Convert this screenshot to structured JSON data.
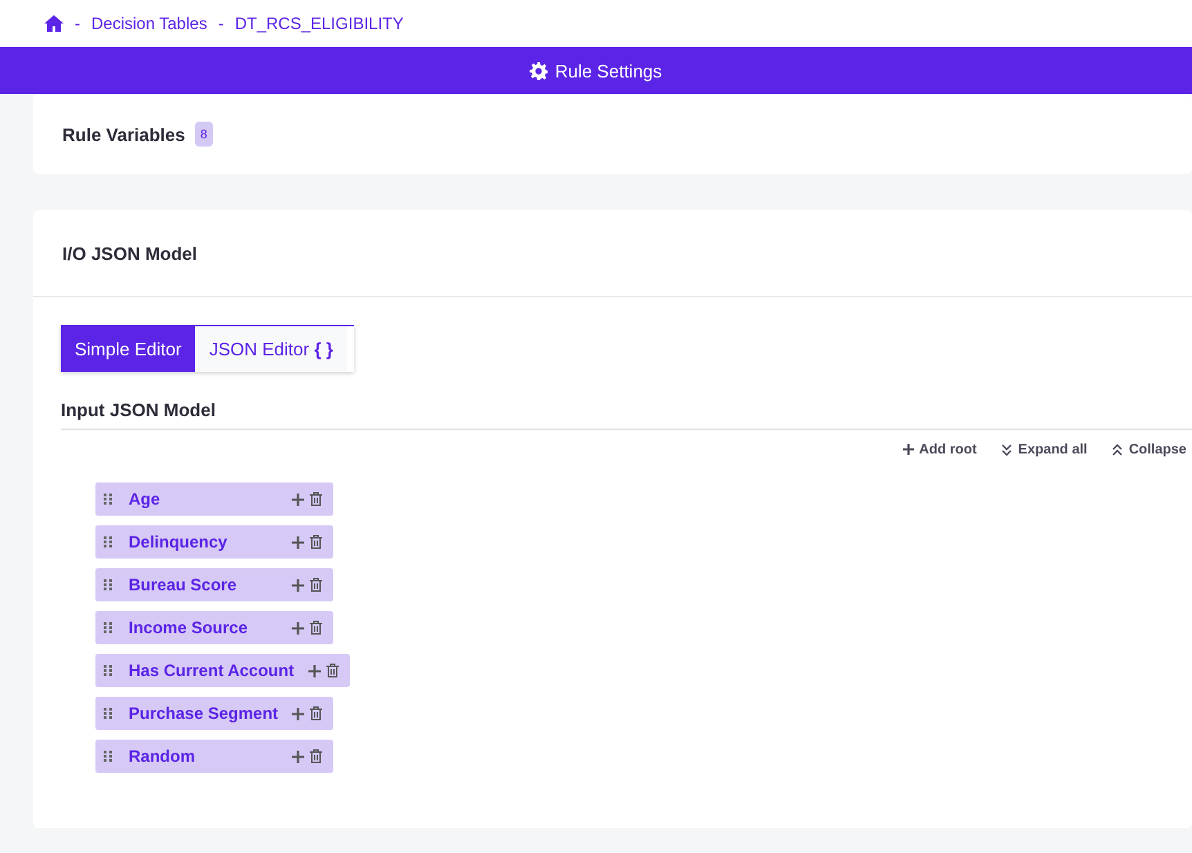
{
  "breadcrumb": [
    {
      "separator": "-",
      "label": "Decision Tables"
    },
    {
      "separator": "-",
      "label": "DT_RCS_ELIGIBILITY"
    }
  ],
  "header_bar": {
    "title": "Rule Settings"
  },
  "rule_variables": {
    "title": "Rule Variables",
    "count": "8"
  },
  "io_model": {
    "title": "I/O JSON Model",
    "tabs": [
      {
        "label": "Simple Editor",
        "selected": true
      },
      {
        "label": "JSON Editor",
        "icon_text": "{ }",
        "selected": false
      }
    ],
    "section_title": "Input JSON Model",
    "actions": [
      {
        "label": "Add root",
        "kind": "add"
      },
      {
        "label": "Expand all",
        "kind": "expand"
      },
      {
        "label": "Collapse",
        "kind": "collapse"
      }
    ],
    "nodes": [
      {
        "label": "Age"
      },
      {
        "label": "Delinquency"
      },
      {
        "label": "Bureau Score"
      },
      {
        "label": "Income Source"
      },
      {
        "label": "Has Current Account"
      },
      {
        "label": "Purchase Segment"
      },
      {
        "label": "Random"
      }
    ]
  }
}
